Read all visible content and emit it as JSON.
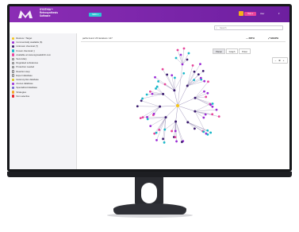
{
  "header": {
    "brand_line1": "SYNTHIA™",
    "brand_line2": "Retrosynthesis",
    "brand_line3": "Software",
    "pill_label": "NEW ▾",
    "user_button": "Help ▾",
    "user_name": "User",
    "user_caret": "▾"
  },
  "search": {
    "placeholder": "Search"
  },
  "legend": {
    "items": [
      {
        "label": "Restore / Target",
        "color": "#f5c518"
      },
      {
        "label": "Commercially available (6)",
        "color": "#9b2bd6"
      },
      {
        "label": "Unknown chemical (7)",
        "color": "#3a1a6e"
      },
      {
        "label": "Known chemical ( )",
        "color": "#18b8c9"
      },
      {
        "label": "Available at www.sigmaaldrich.com",
        "color": "#e8439b"
      },
      {
        "label": "Secondary",
        "color": "#ffffff"
      },
      {
        "label": "Regulated substances",
        "color": "#ffffff"
      },
      {
        "label": "Protection needed",
        "color": "#ffffff"
      },
      {
        "label": "Reaction step",
        "color": "#ffffff"
      },
      {
        "label": "Expert database",
        "color": "#ffffff"
      },
      {
        "label": "Heterocycles database",
        "color": "#d9c216"
      },
      {
        "label": "Arenes database",
        "color": "#9b2bd6"
      },
      {
        "label": "Specialized database",
        "color": "#6a5acd"
      },
      {
        "label": "Strategies",
        "color": "#f5a623"
      },
      {
        "label": "Non selective",
        "color": "#e8232b"
      }
    ]
  },
  "main": {
    "path_info": "paths found: 26  Iterations: 147",
    "path_button": "PATH",
    "graph_button": "GRAPH",
    "tabs": [
      "Planar",
      "Graph",
      "Polar"
    ],
    "zoom_label": "− ⊕ +"
  },
  "colors": {
    "purple": "#9b2bd6",
    "pink": "#e8439b",
    "cyan": "#18b8c9",
    "dark": "#3a1a6e",
    "yellow": "#f5c518"
  }
}
